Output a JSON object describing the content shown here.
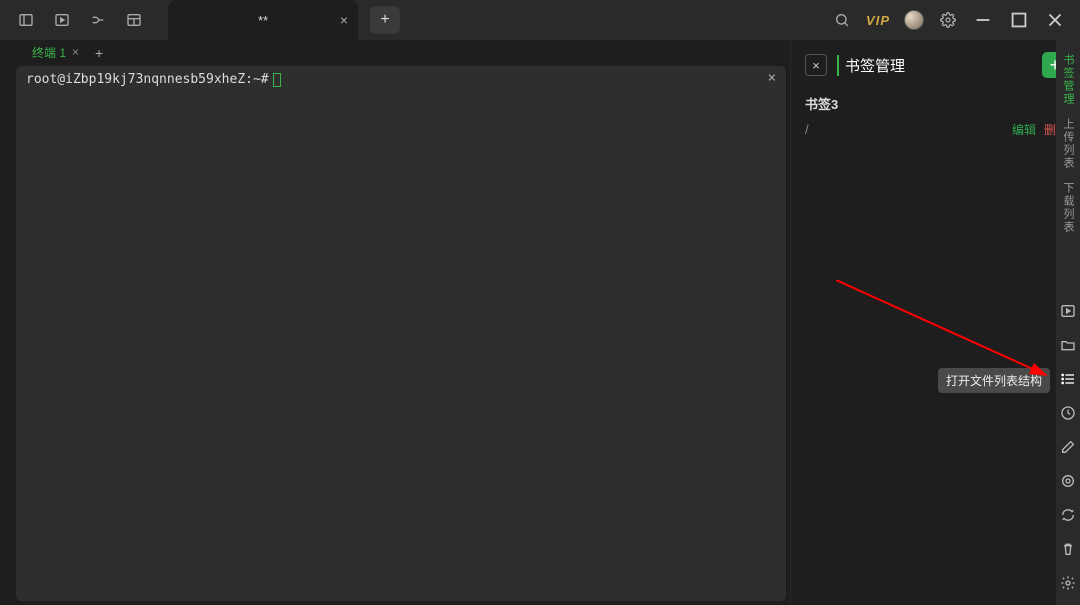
{
  "titlebar": {
    "tab_label": "**",
    "add_label": "+",
    "vip": "VIP"
  },
  "terminal": {
    "tab_label": "终端 1",
    "prompt": "root@iZbp19kj73nqnnesb59xheZ:~#"
  },
  "bookmarks": {
    "title": "书签管理",
    "item_name": "书签3",
    "item_path": "/",
    "edit": "编辑",
    "delete": "删除"
  },
  "rail": {
    "tab1": "书签管理",
    "tab2": "上传列表",
    "tab3": "下载列表"
  },
  "tooltip": "打开文件列表结构"
}
